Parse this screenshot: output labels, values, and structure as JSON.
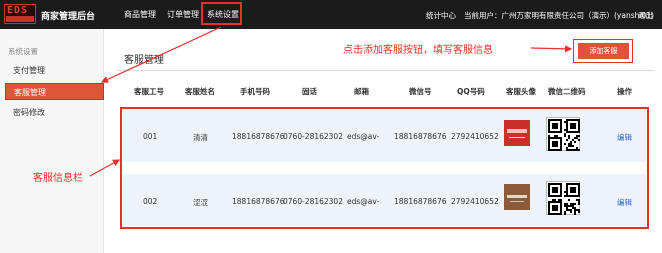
{
  "header": {
    "logo_text": "EDS",
    "brand": "商家管理后台",
    "nav": [
      "商品管理",
      "订单管理",
      "系统设置"
    ],
    "stats": "统计中心",
    "current_user": "当前用户：广州万家明有限责任公司（演示）(yanshi01)",
    "logout": "退出"
  },
  "sidebar": {
    "section": "系统设置",
    "items": [
      "支付管理",
      "客服管理",
      "密码修改"
    ]
  },
  "main": {
    "title": "客服管理",
    "add_button": "添加客服",
    "annotation_add": "点击添加客服按钮，填写客服信息",
    "annotation_info": "客服信息栏"
  },
  "table": {
    "headers": [
      "客服工号",
      "客服姓名",
      "手机号码",
      "固话",
      "邮箱",
      "微信号",
      "QQ号码",
      "客服头像",
      "微信二维码",
      "操作"
    ],
    "rows": [
      {
        "id": "001",
        "name": "清清",
        "phone": "18816878676",
        "tel": "0760-28162302",
        "email": "eds@av-",
        "wechat": "18816878676",
        "qq": "2792410652",
        "action": "编辑"
      },
      {
        "id": "002",
        "name": "涩涩",
        "phone": "18816878676",
        "tel": "0760-28162302",
        "email": "eds@av-",
        "wechat": "18816878676",
        "qq": "2792410652",
        "action": "编辑"
      }
    ]
  },
  "colors": {
    "header_bg": "#1b1b1b",
    "accent": "#e0533a",
    "annotation_red": "#e8302a",
    "row_bg": "#eef3fa",
    "link": "#2d6db5"
  }
}
